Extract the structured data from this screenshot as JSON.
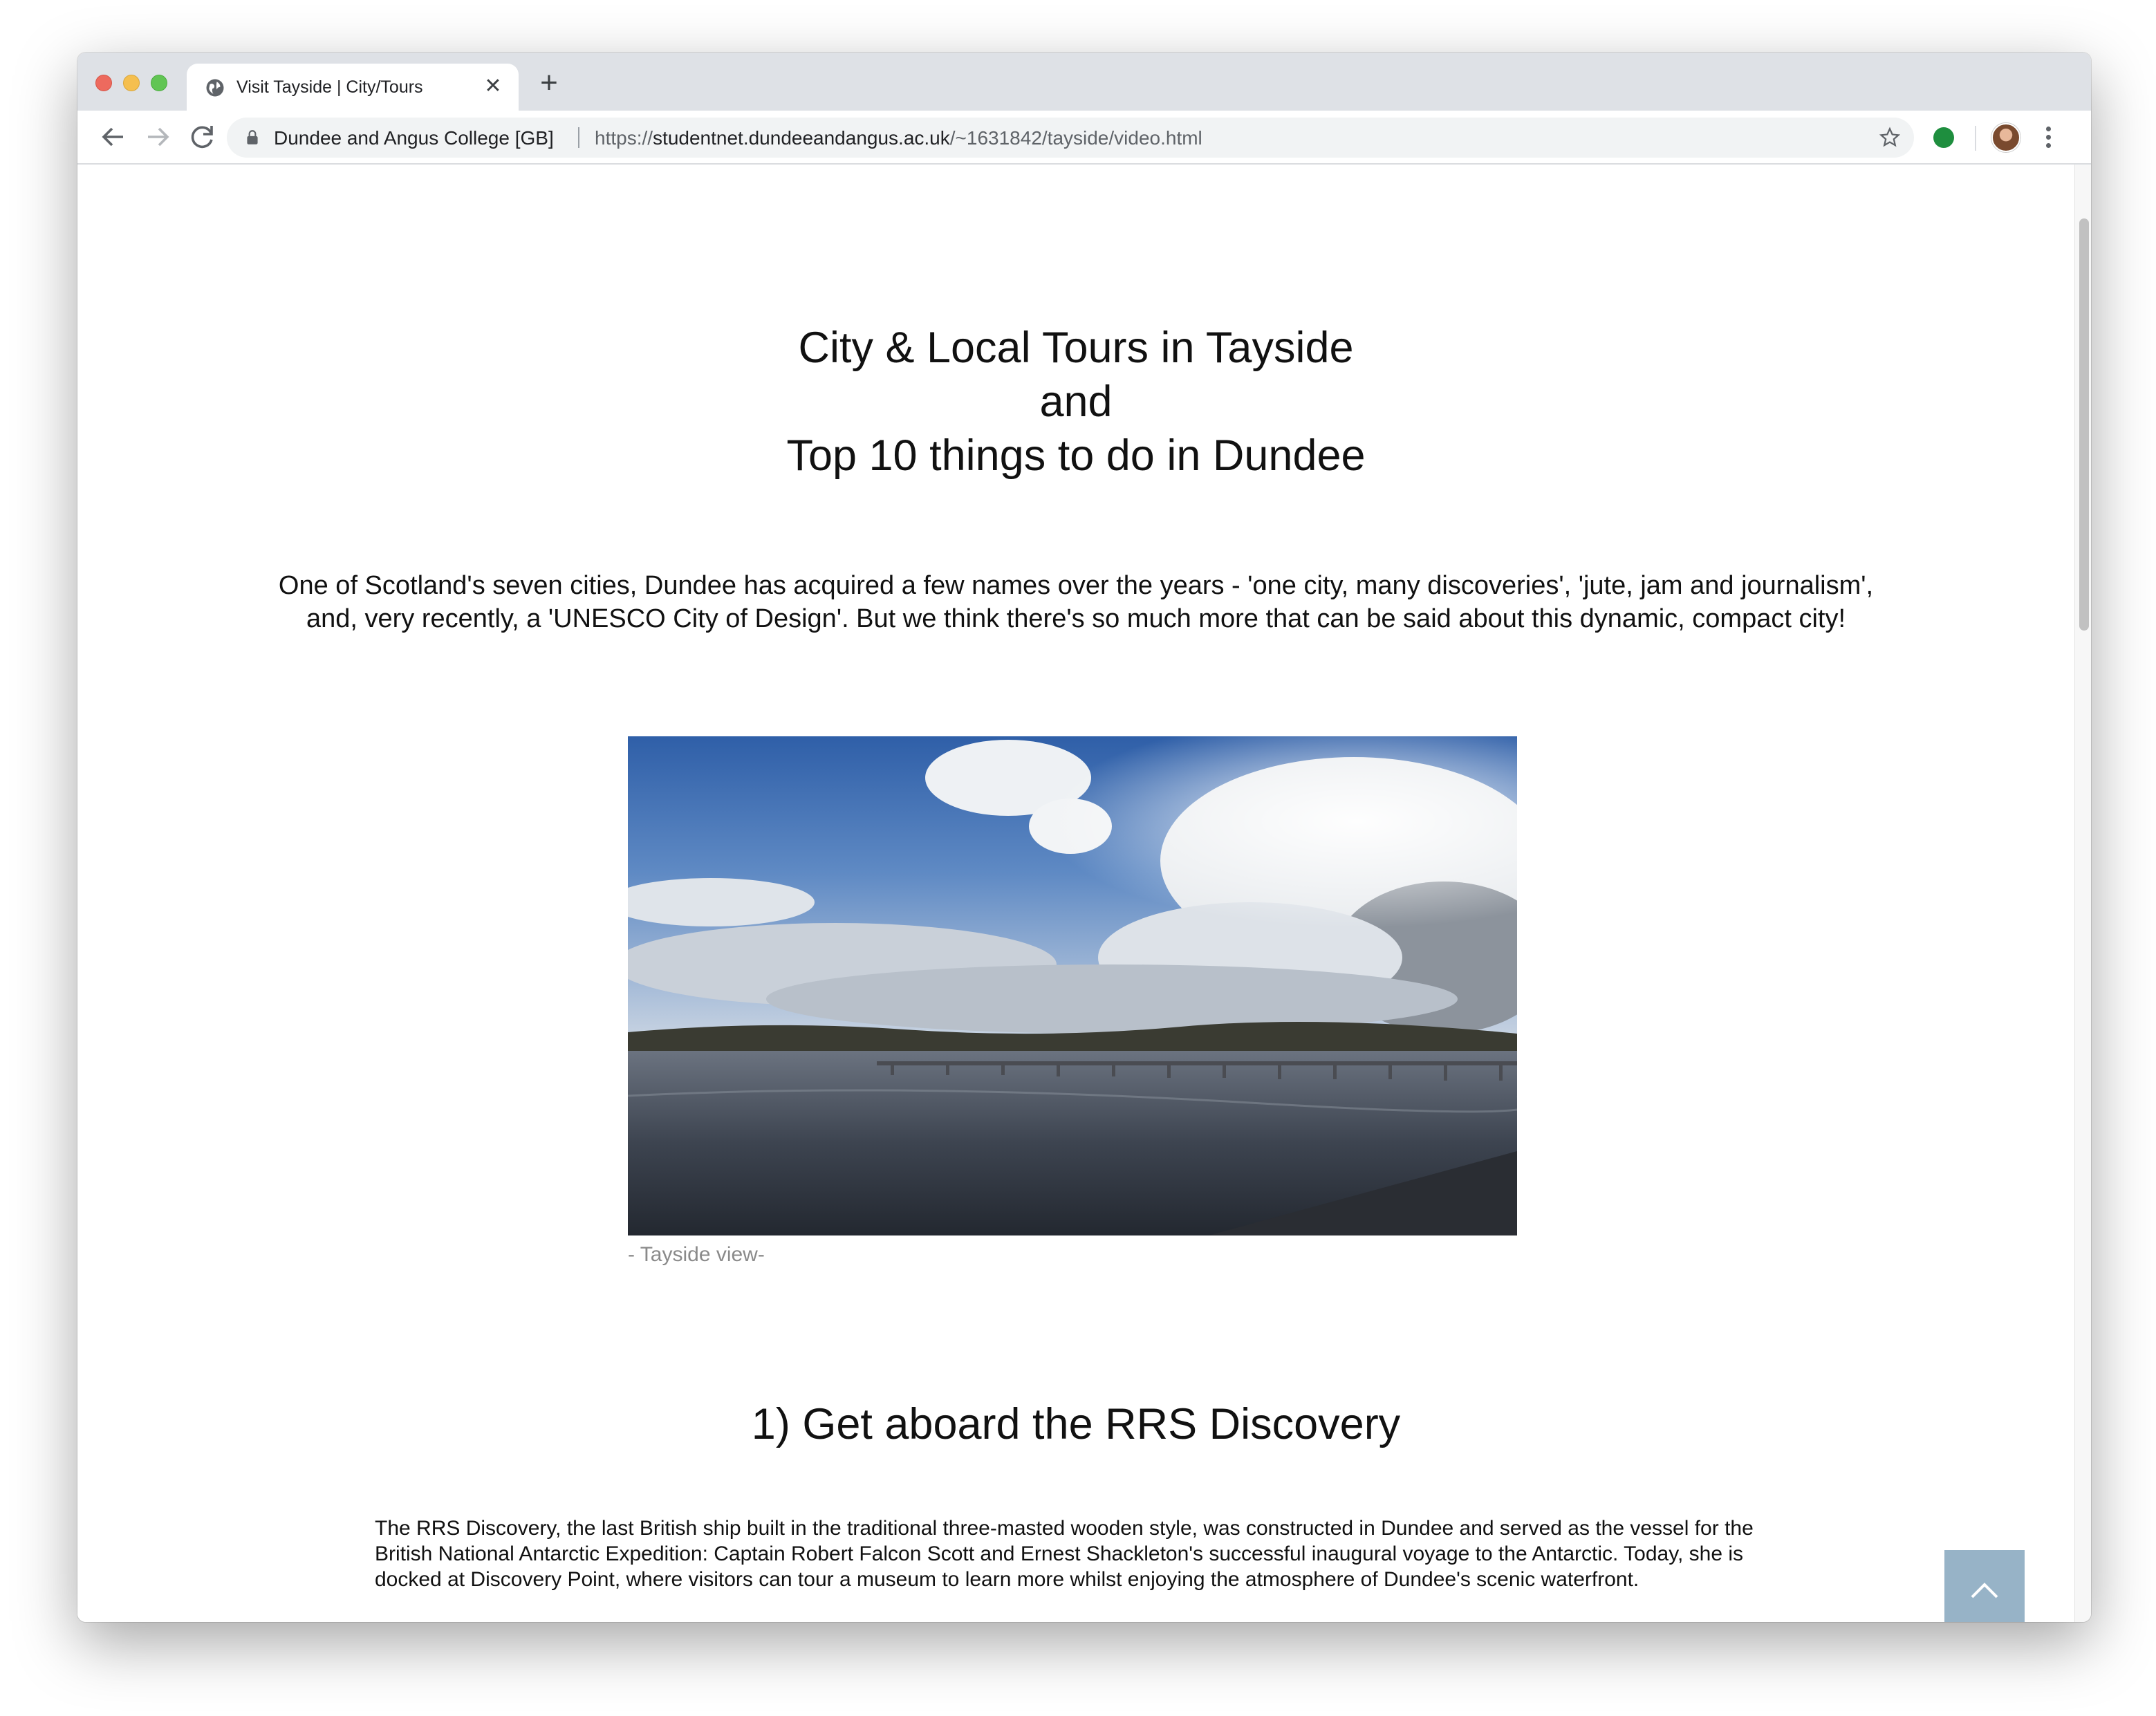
{
  "browser": {
    "tab_title": "Visit Tayside | City/Tours",
    "tab_close": "✕",
    "new_tab": "+",
    "site_identity": "Dundee and Angus College [GB]",
    "url_scheme": "https://",
    "url_host": "studentnet.dundeeandangus.ac.uk",
    "url_path": "/~1631842/tayside/video.html"
  },
  "page": {
    "headline_line1": "City & Local Tours in Tayside",
    "headline_line2": "and",
    "headline_line3": "Top 10 things to do in Dundee",
    "intro": "One of Scotland's seven cities, Dundee has acquired a few names over the years - 'one city, many discoveries', 'jute, jam and journalism', and, very recently, a 'UNESCO City of Design'. But we think there's so much more that can be said about this dynamic, compact city!",
    "photo_caption": "- Tayside view-",
    "section1_title": "1) Get aboard the RRS Discovery",
    "section1_body": "The RRS Discovery, the last British ship built in the traditional three-masted wooden style, was constructed in Dundee and served as the vessel for the British National Antarctic Expedition: Captain Robert Falcon Scott and Ernest Shackleton's successful inaugural voyage to the Antarctic. Today, she is docked at Discovery Point, where visitors can tour a museum to learn more whilst enjoying the atmosphere of Dundee's scenic waterfront."
  },
  "icons": {
    "favicon": "globe-icon",
    "back": "arrow-left-icon",
    "forward": "arrow-right-icon",
    "reload": "reload-icon",
    "lock": "lock-icon",
    "bookmark": "star-icon",
    "extension": "extension-icon",
    "profile": "avatar",
    "menu": "kebab-menu-icon",
    "back_to_top": "chevron-up-icon"
  },
  "colors": {
    "back_to_top_bg": "#97b3c7",
    "tabstrip_bg": "#dee1e6"
  }
}
